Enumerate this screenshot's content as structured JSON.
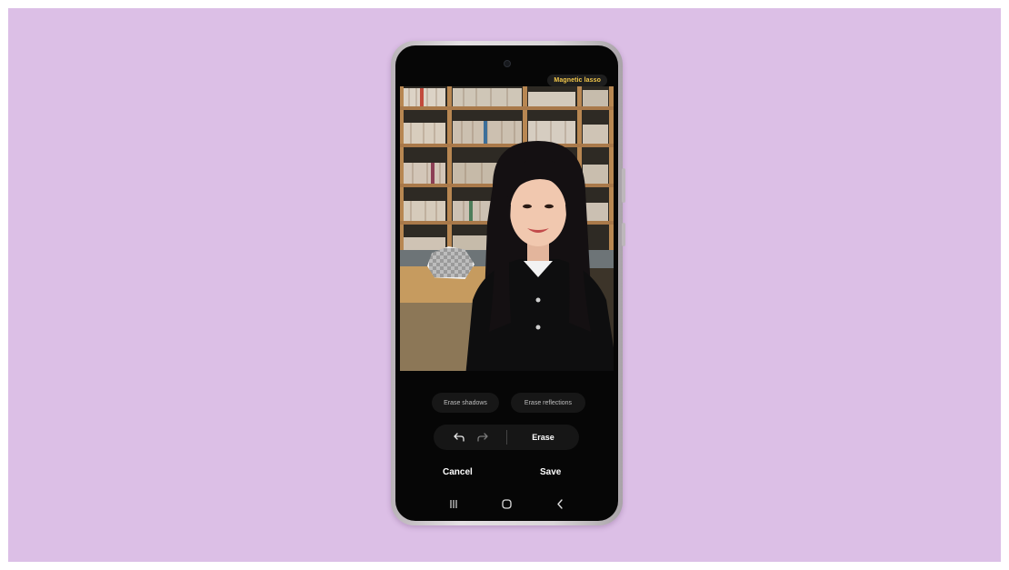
{
  "editor": {
    "tool_label": "Magnetic lasso",
    "suggestions": {
      "erase_shadows": "Erase shadows",
      "erase_reflections": "Erase reflections"
    },
    "actions": {
      "undo_icon": "undo-icon",
      "redo_icon": "redo-icon",
      "erase_label": "Erase"
    },
    "footer": {
      "cancel_label": "Cancel",
      "save_label": "Save"
    }
  },
  "navbar": {
    "icons": [
      "recent-apps-icon",
      "home-icon",
      "back-icon"
    ]
  },
  "colors": {
    "background": "#dcbfe6",
    "tool_label": "#f3c74a",
    "screen": "#060606"
  }
}
